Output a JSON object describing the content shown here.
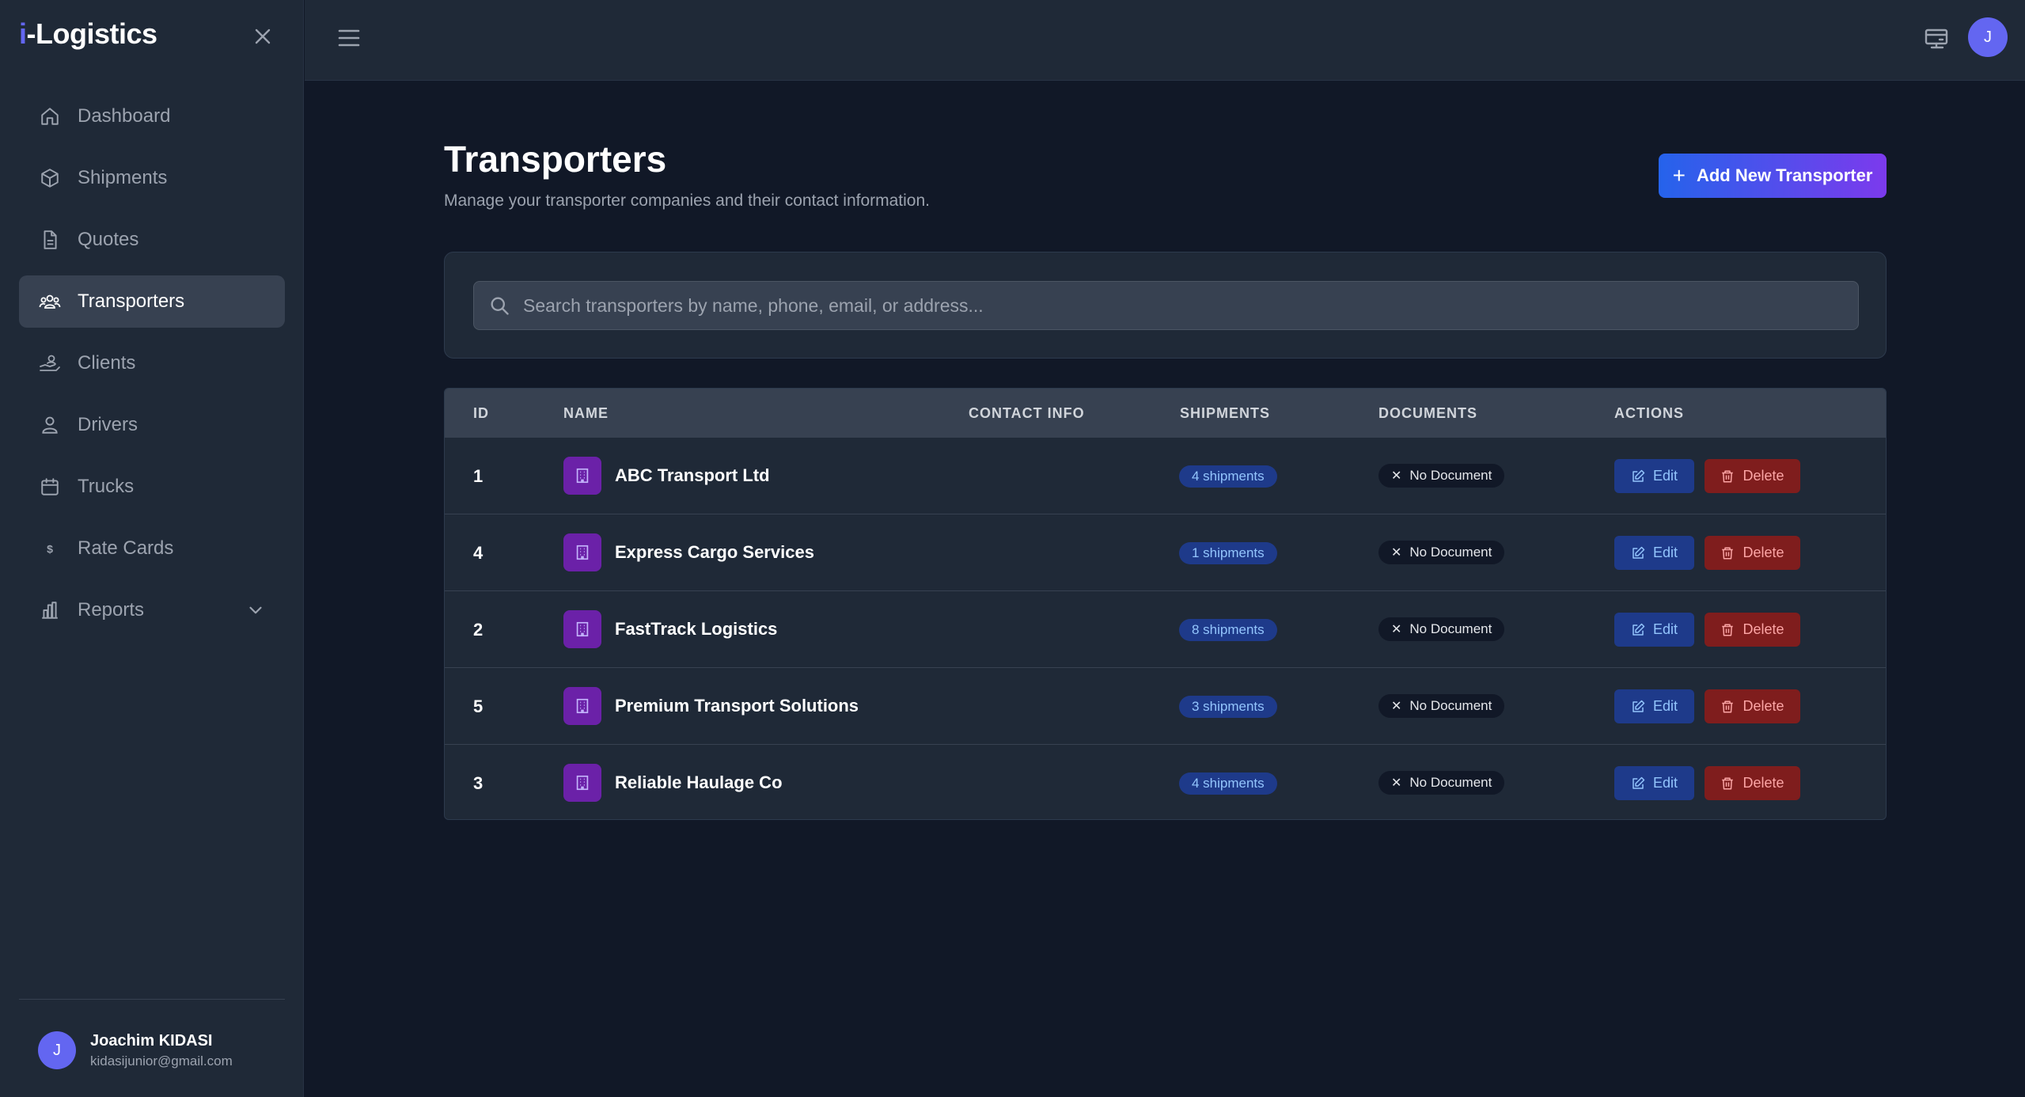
{
  "brand": {
    "prefix": "i",
    "rest": "-Logistics",
    "accent_color": "#6366f1"
  },
  "sidebar": {
    "items": [
      {
        "label": "Dashboard",
        "icon": "home-icon"
      },
      {
        "label": "Shipments",
        "icon": "box-icon"
      },
      {
        "label": "Quotes",
        "icon": "document-icon"
      },
      {
        "label": "Transporters",
        "icon": "users-icon",
        "active": true
      },
      {
        "label": "Clients",
        "icon": "client-icon"
      },
      {
        "label": "Drivers",
        "icon": "user-icon"
      },
      {
        "label": "Trucks",
        "icon": "calendar-icon"
      },
      {
        "label": "Rate Cards",
        "icon": "dollar-icon"
      },
      {
        "label": "Reports",
        "icon": "bar-chart-icon",
        "expandable": true
      }
    ],
    "user": {
      "initial": "J",
      "name": "Joachim KIDASI",
      "email": "kidasijunior@gmail.com"
    }
  },
  "topbar": {
    "avatar_initial": "J"
  },
  "page": {
    "title": "Transporters",
    "subtitle": "Manage your transporter companies and their contact information.",
    "add_button": "Add New Transporter"
  },
  "search": {
    "placeholder": "Search transporters by name, phone, email, or address..."
  },
  "table": {
    "headers": {
      "id": "ID",
      "name": "NAME",
      "contact": "CONTACT INFO",
      "shipments": "SHIPMENTS",
      "documents": "DOCUMENTS",
      "actions": "ACTIONS"
    },
    "rows": [
      {
        "id": "1",
        "name": "ABC Transport Ltd",
        "shipments": "4 shipments",
        "document": "No Document",
        "edit": "Edit",
        "delete": "Delete"
      },
      {
        "id": "4",
        "name": "Express Cargo Services",
        "shipments": "1 shipments",
        "document": "No Document",
        "edit": "Edit",
        "delete": "Delete"
      },
      {
        "id": "2",
        "name": "FastTrack Logistics",
        "shipments": "8 shipments",
        "document": "No Document",
        "edit": "Edit",
        "delete": "Delete"
      },
      {
        "id": "5",
        "name": "Premium Transport Solutions",
        "shipments": "3 shipments",
        "document": "No Document",
        "edit": "Edit",
        "delete": "Delete"
      },
      {
        "id": "3",
        "name": "Reliable Haulage Co",
        "shipments": "4 shipments",
        "document": "No Document",
        "edit": "Edit",
        "delete": "Delete"
      }
    ]
  }
}
